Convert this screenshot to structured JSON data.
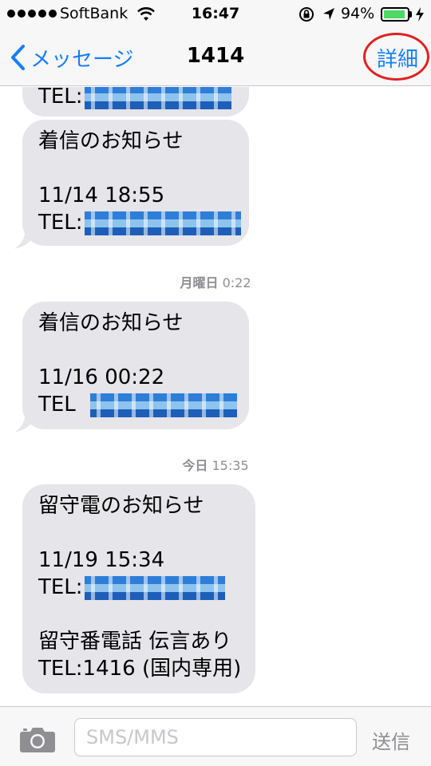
{
  "status_bar": {
    "carrier": "SoftBank",
    "time": "16:47",
    "battery_percent": "94%",
    "battery_level": 0.94,
    "signal_dots": 5,
    "icons": [
      "wifi-icon",
      "rotation-lock-icon",
      "location-arrow-icon",
      "battery-icon",
      "charging-bolt-icon"
    ]
  },
  "nav": {
    "back_label": "メッセージ",
    "title": "1414",
    "details_label": "詳細",
    "highlight_color": "#e02020"
  },
  "messages": [
    {
      "lines": [
        "TEL:"
      ]
    },
    {
      "lines": [
        "着信のお知らせ",
        "",
        "11/14 18:55",
        "TEL:"
      ]
    },
    {
      "lines": [
        "着信のお知らせ",
        "",
        "11/16 00:22",
        "TEL"
      ]
    },
    {
      "lines": [
        "留守電のお知らせ",
        "",
        "11/19 15:34",
        "TEL:",
        "",
        "留守番電話 伝言あり",
        "TEL:1416 (国内専用)"
      ]
    }
  ],
  "timestamps": [
    {
      "day": "月曜日",
      "time": "0:22"
    },
    {
      "day": "今日",
      "time": "15:35"
    }
  ],
  "input": {
    "placeholder": "SMS/MMS",
    "send_label": "送信"
  },
  "colors": {
    "accent": "#157efb",
    "bubble": "#e5e5ea",
    "bar": "#f7f7f8",
    "muted": "#8e8e93"
  }
}
